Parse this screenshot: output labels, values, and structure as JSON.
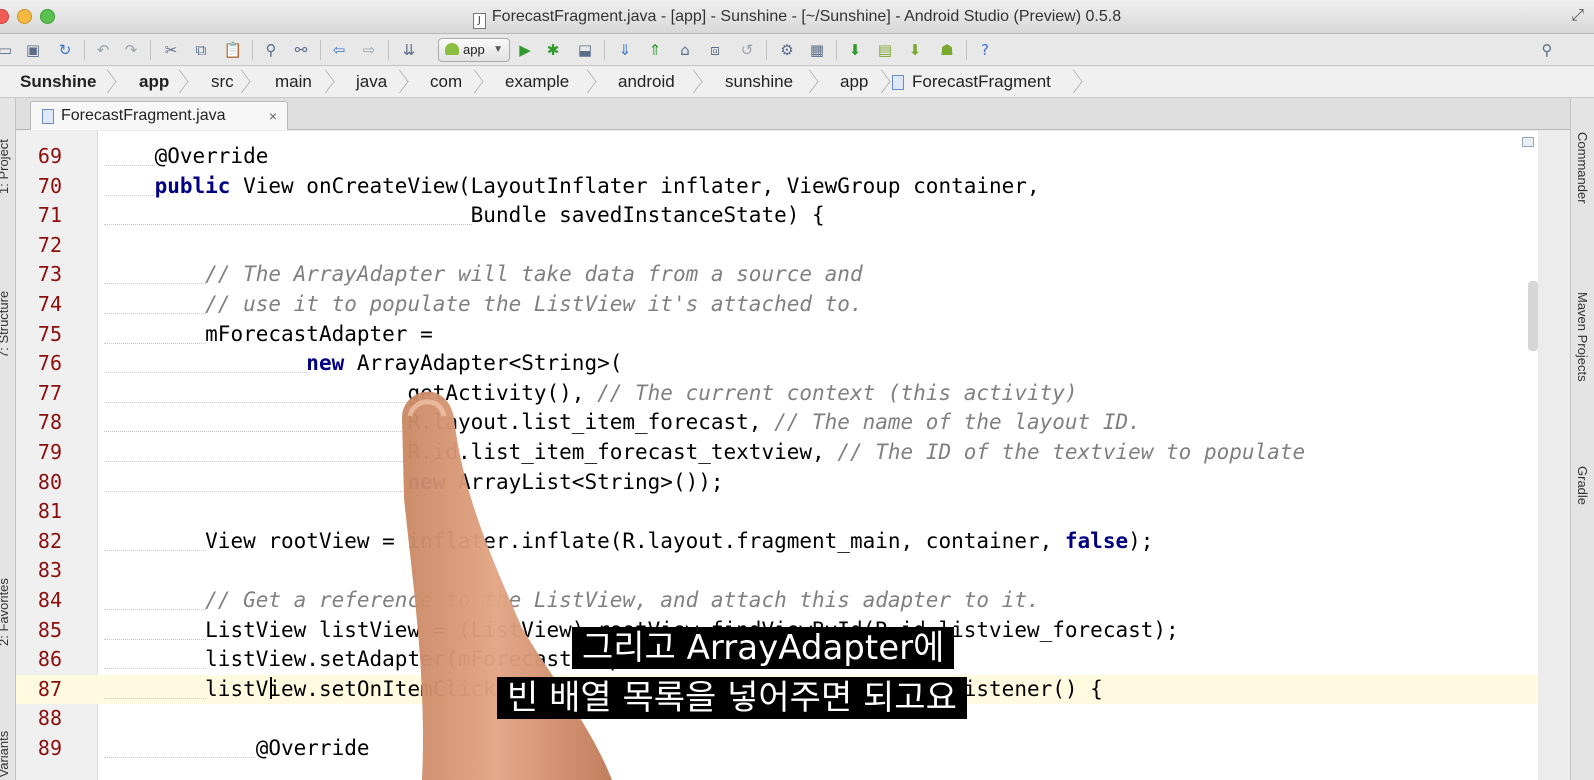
{
  "window": {
    "title": "ForecastFragment.java - [app] - Sunshine - [~/Sunshine] - Android Studio (Preview) 0.5.8"
  },
  "toolbar": {
    "run_config": "app",
    "help_label": "?"
  },
  "breadcrumb": [
    "Sunshine",
    "app",
    "src",
    "main",
    "java",
    "com",
    "example",
    "android",
    "sunshine",
    "app",
    "ForecastFragment"
  ],
  "left_tools": [
    "1: Project",
    "7: Structure",
    "2: Favorites",
    "Build Variants"
  ],
  "right_tools": [
    "Commander",
    "Maven Projects",
    "Gradle"
  ],
  "editor": {
    "tab_label": "ForecastFragment.java",
    "lines": [
      {
        "n": "69",
        "indent": "    ",
        "code": "@Override"
      },
      {
        "n": "70",
        "indent": "    ",
        "kw": "public",
        "code": " View onCreateView(LayoutInflater inflater, ViewGroup container,"
      },
      {
        "n": "71",
        "indent": "                             ",
        "code": "Bundle savedInstanceState) {"
      },
      {
        "n": "72",
        "indent": "",
        "code": ""
      },
      {
        "n": "73",
        "indent": "        ",
        "comment": "// The ArrayAdapter will take data from a source and"
      },
      {
        "n": "74",
        "indent": "        ",
        "comment": "// use it to populate the ListView it's attached to."
      },
      {
        "n": "75",
        "indent": "        ",
        "code": "mForecastAdapter ="
      },
      {
        "n": "76",
        "indent": "                ",
        "kw": "new",
        "code": " ArrayAdapter<String>("
      },
      {
        "n": "77",
        "indent": "                        ",
        "code": "getActivity(), ",
        "comment": "// The current context (this activity)"
      },
      {
        "n": "78",
        "indent": "                        ",
        "code": "R.layout.list_item_forecast, ",
        "comment": "// The name of the layout ID."
      },
      {
        "n": "79",
        "indent": "                        ",
        "code": "R.id.list_item_forecast_textview, ",
        "comment": "// The ID of the textview to populate"
      },
      {
        "n": "80",
        "indent": "                        ",
        "kw": "new",
        "code": " ArrayList<String>());"
      },
      {
        "n": "81",
        "indent": "",
        "code": ""
      },
      {
        "n": "82",
        "indent": "        ",
        "code": "View rootView = inflater.inflate(R.layout.fragment_main, container, ",
        "kw2": "false",
        "code2": ");"
      },
      {
        "n": "83",
        "indent": "",
        "code": ""
      },
      {
        "n": "84",
        "indent": "        ",
        "comment": "// Get a reference to the ListView, and attach this adapter to it."
      },
      {
        "n": "85",
        "indent": "        ",
        "code": "ListView listView = (ListView) rootView.findViewById(R.id.listview_forecast);"
      },
      {
        "n": "86",
        "indent": "        ",
        "code": "listView.setAdapter(mForecastAdapter);"
      },
      {
        "n": "87",
        "indent": "        ",
        "code": "listView.setOnItemClickListener(new AdapterView.OnItemClickListener() {"
      },
      {
        "n": "88",
        "indent": "",
        "code": ""
      },
      {
        "n": "89",
        "indent": "            ",
        "code": "@Override"
      }
    ]
  },
  "subtitles": {
    "line1": "그리고 ArrayAdapter에",
    "line2": "빈 배열 목록을 넣어주면 되고요"
  }
}
